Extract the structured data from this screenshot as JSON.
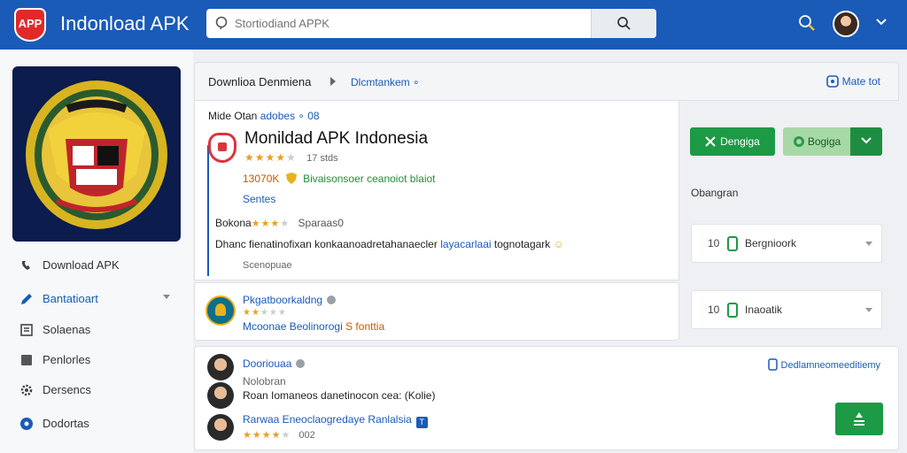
{
  "header": {
    "logo_text": "APP",
    "title": "Indonload APK",
    "search_placeholder": "Stortiodiand APPK"
  },
  "sidebar": {
    "items": [
      {
        "label": "Download APK",
        "icon": "phone-icon"
      },
      {
        "label": "Bantatioart",
        "icon": "pen-icon",
        "has_dropdown": true
      },
      {
        "label": "Solaenas",
        "icon": "list-icon"
      },
      {
        "label": "Penlorles",
        "icon": "square-icon"
      },
      {
        "label": "Dersencs",
        "icon": "gear-icon"
      },
      {
        "label": "Dodortas",
        "icon": "circle-icon"
      }
    ]
  },
  "breadcrumb": {
    "current": "Downlioa Denmiena",
    "link": "Dlcmtankem ∘",
    "right_link": "Mate tot"
  },
  "app": {
    "meta_label": "Mide Otan",
    "meta_link": "adobes ∘ 08",
    "name": "Monildad APK Indonesia",
    "rating_stars": 3.5,
    "rating_count": "17 stds",
    "size": "13070K",
    "info": "Bivaisonsoer ceanoiot blaiot",
    "category": "Sentes",
    "version_label": "Bokona",
    "version_sub": "Sparaas0",
    "description_start": "Dhanc fienatinofixan konkaanoadretahanaecler",
    "description_link": "layacarlaai",
    "description_end": "tognotagark",
    "description_foot": "Scenopuae"
  },
  "actions": {
    "download_label": "Dengiga",
    "secondary_label": "Bogiga",
    "compare_label": "Obangran",
    "selects": [
      {
        "num": "10",
        "label": "Bergnioork"
      },
      {
        "num": "10",
        "label": "Inaoatik"
      }
    ]
  },
  "related": {
    "title": "Pkgatboorkaldng",
    "rating_stars": 2,
    "meta_start": "Mcoonae Beolinorogi",
    "meta_highlight": "S fonttia"
  },
  "comments": {
    "author": "Dooriouaa",
    "subtitle": "Nolobran",
    "text": "Roan Iomaneos danetinocon cea: (Kolie)",
    "second_author": "Rarwaa Eneoclaogredaye Ranlalsia",
    "second_tag": "T",
    "second_rating_stars": 4,
    "second_rating_count": "002",
    "right_link": "Dedlamneomeeditiemy"
  },
  "colors": {
    "header": "#1a5bb8",
    "accent_green": "#1d9a46",
    "link_blue": "#1a5bb8"
  }
}
